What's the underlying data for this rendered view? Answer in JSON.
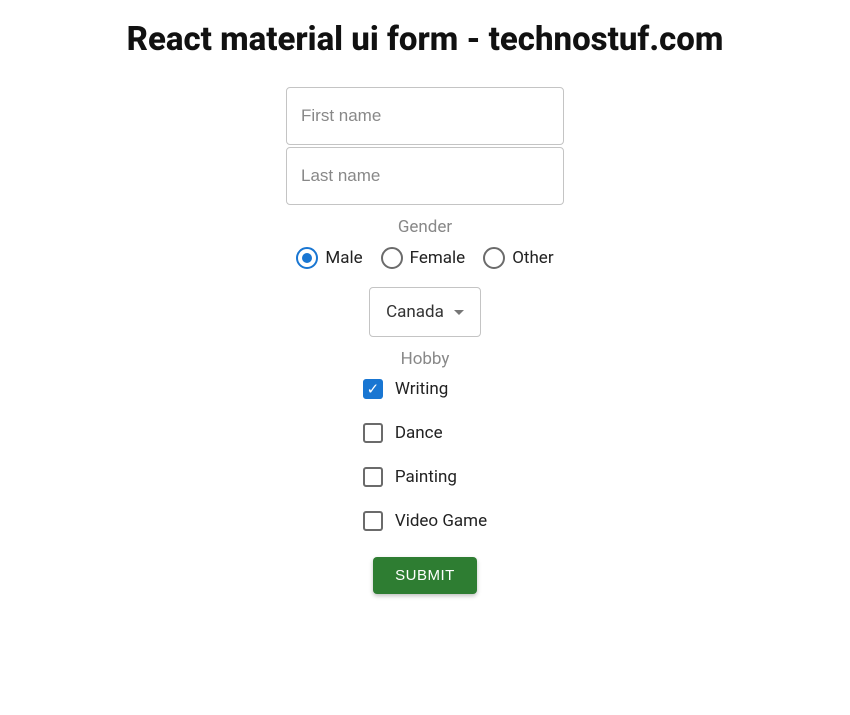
{
  "title": "React material ui form - technostuf.com",
  "fields": {
    "first_name": {
      "placeholder": "First name",
      "value": ""
    },
    "last_name": {
      "placeholder": "Last name",
      "value": ""
    }
  },
  "gender": {
    "label": "Gender",
    "selected": "male",
    "options": [
      {
        "key": "male",
        "label": "Male"
      },
      {
        "key": "female",
        "label": "Female"
      },
      {
        "key": "other",
        "label": "Other"
      }
    ]
  },
  "country": {
    "selected_label": "Canada"
  },
  "hobby": {
    "label": "Hobby",
    "options": [
      {
        "key": "writing",
        "label": "Writing",
        "checked": true
      },
      {
        "key": "dance",
        "label": "Dance",
        "checked": false
      },
      {
        "key": "painting",
        "label": "Painting",
        "checked": false
      },
      {
        "key": "video_game",
        "label": "Video Game",
        "checked": false
      }
    ]
  },
  "submit_label": "SUBMIT"
}
